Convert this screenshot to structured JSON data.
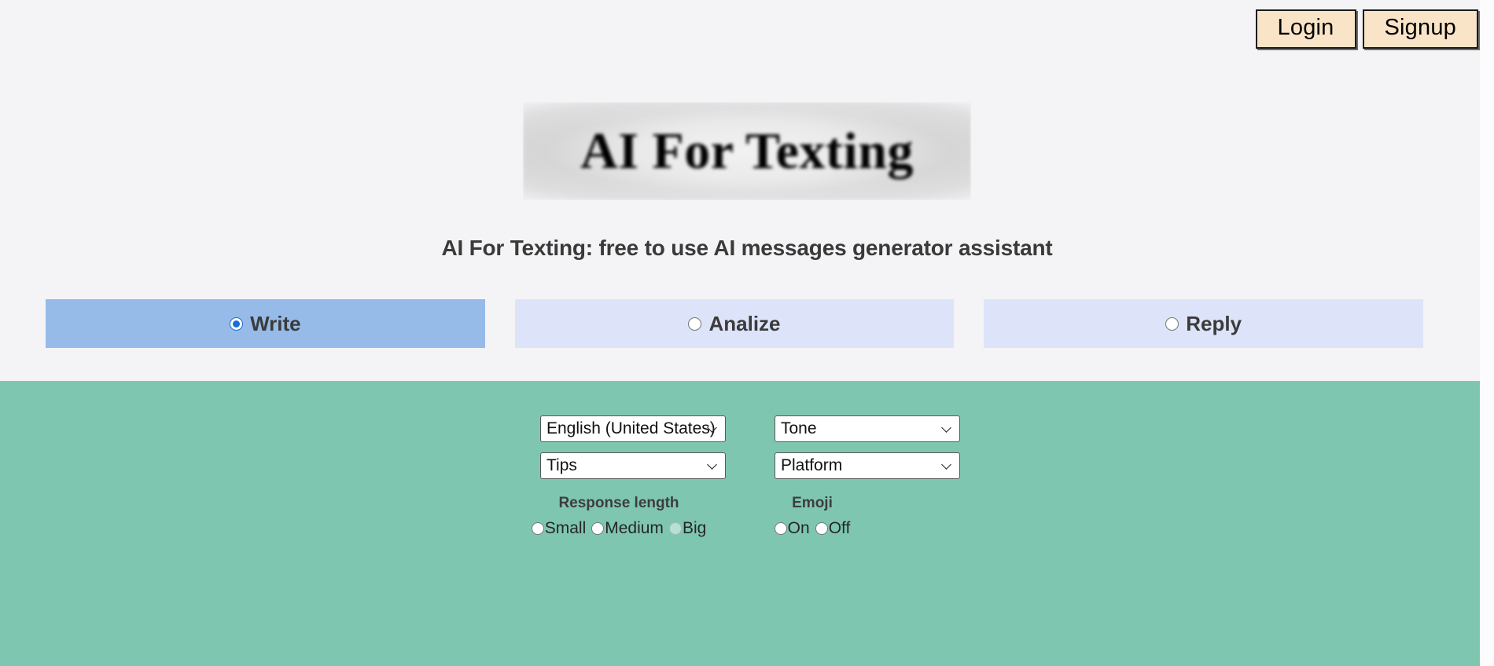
{
  "colors": {
    "page_background": "#f4f4f6",
    "panel_background": "#7fc6b0",
    "tab_selected": "#96bbe8",
    "tab_unselected": "#dde4fa",
    "auth_button": "#fae4c8",
    "radio_accent": "#1b6ed6",
    "heading_text": "#3a3a3a"
  },
  "auth": {
    "login_label": "Login",
    "signup_label": "Signup"
  },
  "logo": {
    "text": "AI For Texting"
  },
  "tagline": "AI For Texting: free to use AI messages generator assistant",
  "tabs": [
    {
      "label": "Write",
      "selected": true
    },
    {
      "label": "Analize",
      "selected": false
    },
    {
      "label": "Reply",
      "selected": false
    }
  ],
  "form": {
    "language_select": {
      "value": "English (United State",
      "full_value": "English (United States)",
      "options": [
        "English (United States)"
      ]
    },
    "tone_select": {
      "value": "Tone",
      "options": [
        "Tone"
      ]
    },
    "tips_select": {
      "value": "Tips",
      "options": [
        "Tips"
      ]
    },
    "platform_select": {
      "value": "Platform",
      "options": [
        "Platform"
      ]
    },
    "response_length": {
      "title": "Response length",
      "options": [
        {
          "label": "Small",
          "selected": false,
          "faded": false
        },
        {
          "label": "Medium",
          "selected": false,
          "faded": false
        },
        {
          "label": "Big",
          "selected": false,
          "faded": true
        }
      ]
    },
    "emoji": {
      "title": "Emoji",
      "options": [
        {
          "label": "On",
          "selected": false,
          "faded": false
        },
        {
          "label": "Off",
          "selected": false,
          "faded": false
        }
      ]
    }
  },
  "icons": {
    "chevron_down": "chevron-down-icon"
  }
}
